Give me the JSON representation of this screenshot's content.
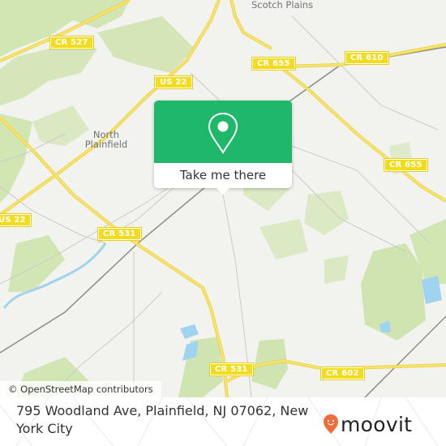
{
  "map": {
    "place_labels": {
      "scotch_plains": "Scotch Plains",
      "north_plainfield": "North Plainfield"
    },
    "road_shields": {
      "cr527": "CR 527",
      "us22_top": "US 22",
      "us22_left": "US 22",
      "cr655_top": "CR 655",
      "cr610": "CR 610",
      "cr655_right": "CR 655",
      "cr531_top": "CR 531",
      "cr531_bottom": "CR 531",
      "cr602": "CR 602"
    },
    "attribution": "© OpenStreetMap contributors",
    "colors": {
      "background": "#f2f2ee",
      "park": "#c9e2a4",
      "water": "#9fd3ef",
      "road": "#f5df50",
      "minor_road": "#c8c8c8"
    }
  },
  "popup": {
    "icon": "location-pin-icon",
    "button_label": "Take me there",
    "color": "#1fb86a"
  },
  "footer": {
    "address": "795 Woodland Ave, Plainfield, NJ 07062, New York City",
    "logo_text": "moovit",
    "logo_color": "#f26b3a"
  }
}
